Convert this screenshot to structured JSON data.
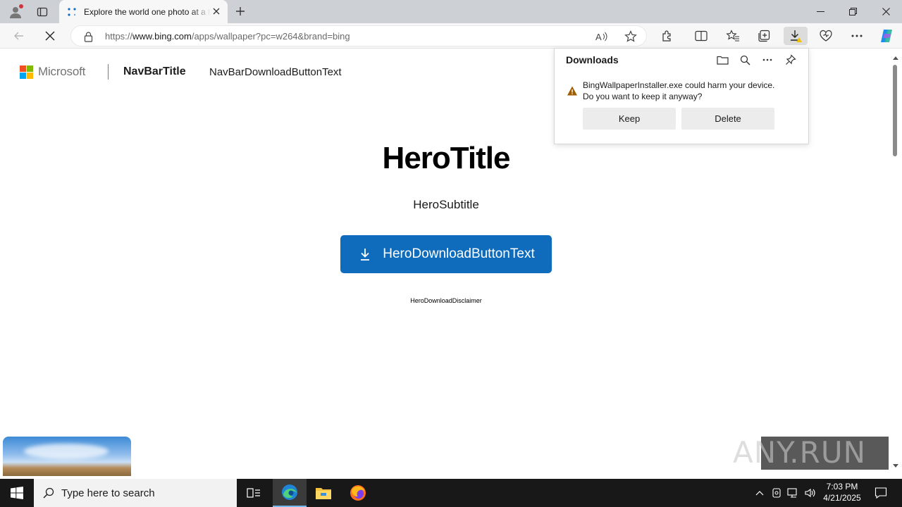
{
  "browser": {
    "tab_title": "Explore the world one photo at a time",
    "url_prefix": "https://",
    "url_host": "www.bing.com",
    "url_path": "/apps/wallpaper?pc=w264&brand=bing"
  },
  "page": {
    "brand_name": "Microsoft",
    "nav_title": "NavBarTitle",
    "nav_download": "NavBarDownloadButtonText",
    "hero_title": "HeroTitle",
    "hero_subtitle": "HeroSubtitle",
    "hero_button": "HeroDownloadButtonText",
    "hero_disclaimer": "HeroDownloadDisclaimer"
  },
  "downloads_panel": {
    "title": "Downloads",
    "warning_line1": "BingWallpaperInstaller.exe could harm your device.",
    "warning_line2": "Do you want to keep it anyway?",
    "keep_label": "Keep",
    "delete_label": "Delete"
  },
  "watermark": {
    "text": "ANY.RUN"
  },
  "taskbar": {
    "search_placeholder": "Type here to search",
    "time": "7:03 PM",
    "date": "4/21/2025"
  },
  "colors": {
    "accent": "#0f6cbd",
    "ms_red": "#f25022",
    "ms_green": "#7fba00",
    "ms_blue": "#00a4ef",
    "ms_yellow": "#ffb900",
    "warning": "#c59800"
  }
}
